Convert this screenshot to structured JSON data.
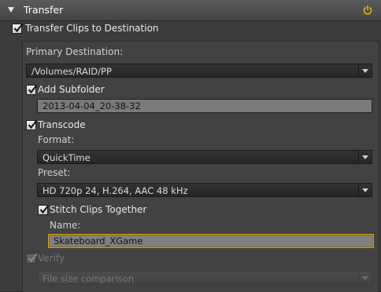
{
  "panel": {
    "title": "Transfer",
    "transfer_clips_label": "Transfer Clips to Destination",
    "primary_destination_label": "Primary Destination:",
    "primary_destination_value": "/Volumes/RAID/PP",
    "add_subfolder_label": "Add Subfolder",
    "subfolder_value": "2013-04-04_20-38-32",
    "transcode_label": "Transcode",
    "format_label": "Format:",
    "format_value": "QuickTime",
    "preset_label": "Preset:",
    "preset_value": "HD 720p 24, H.264, AAC 48 kHz",
    "stitch_label": "Stitch Clips Together",
    "name_label": "Name:",
    "name_value": "Skateboard_XGame",
    "verify_label": "Verify",
    "verify_method_value": "File size comparison"
  },
  "states": {
    "transfer_clips_checked": true,
    "add_subfolder_checked": true,
    "transcode_checked": true,
    "stitch_checked": true,
    "verify_checked": true,
    "verify_enabled": false
  },
  "colors": {
    "accent_focus": "#c9a227",
    "power_icon": "#e0a800"
  },
  "icons": {
    "collapse": "triangle-down",
    "power": "power-icon",
    "dropdown": "triangle-down"
  }
}
